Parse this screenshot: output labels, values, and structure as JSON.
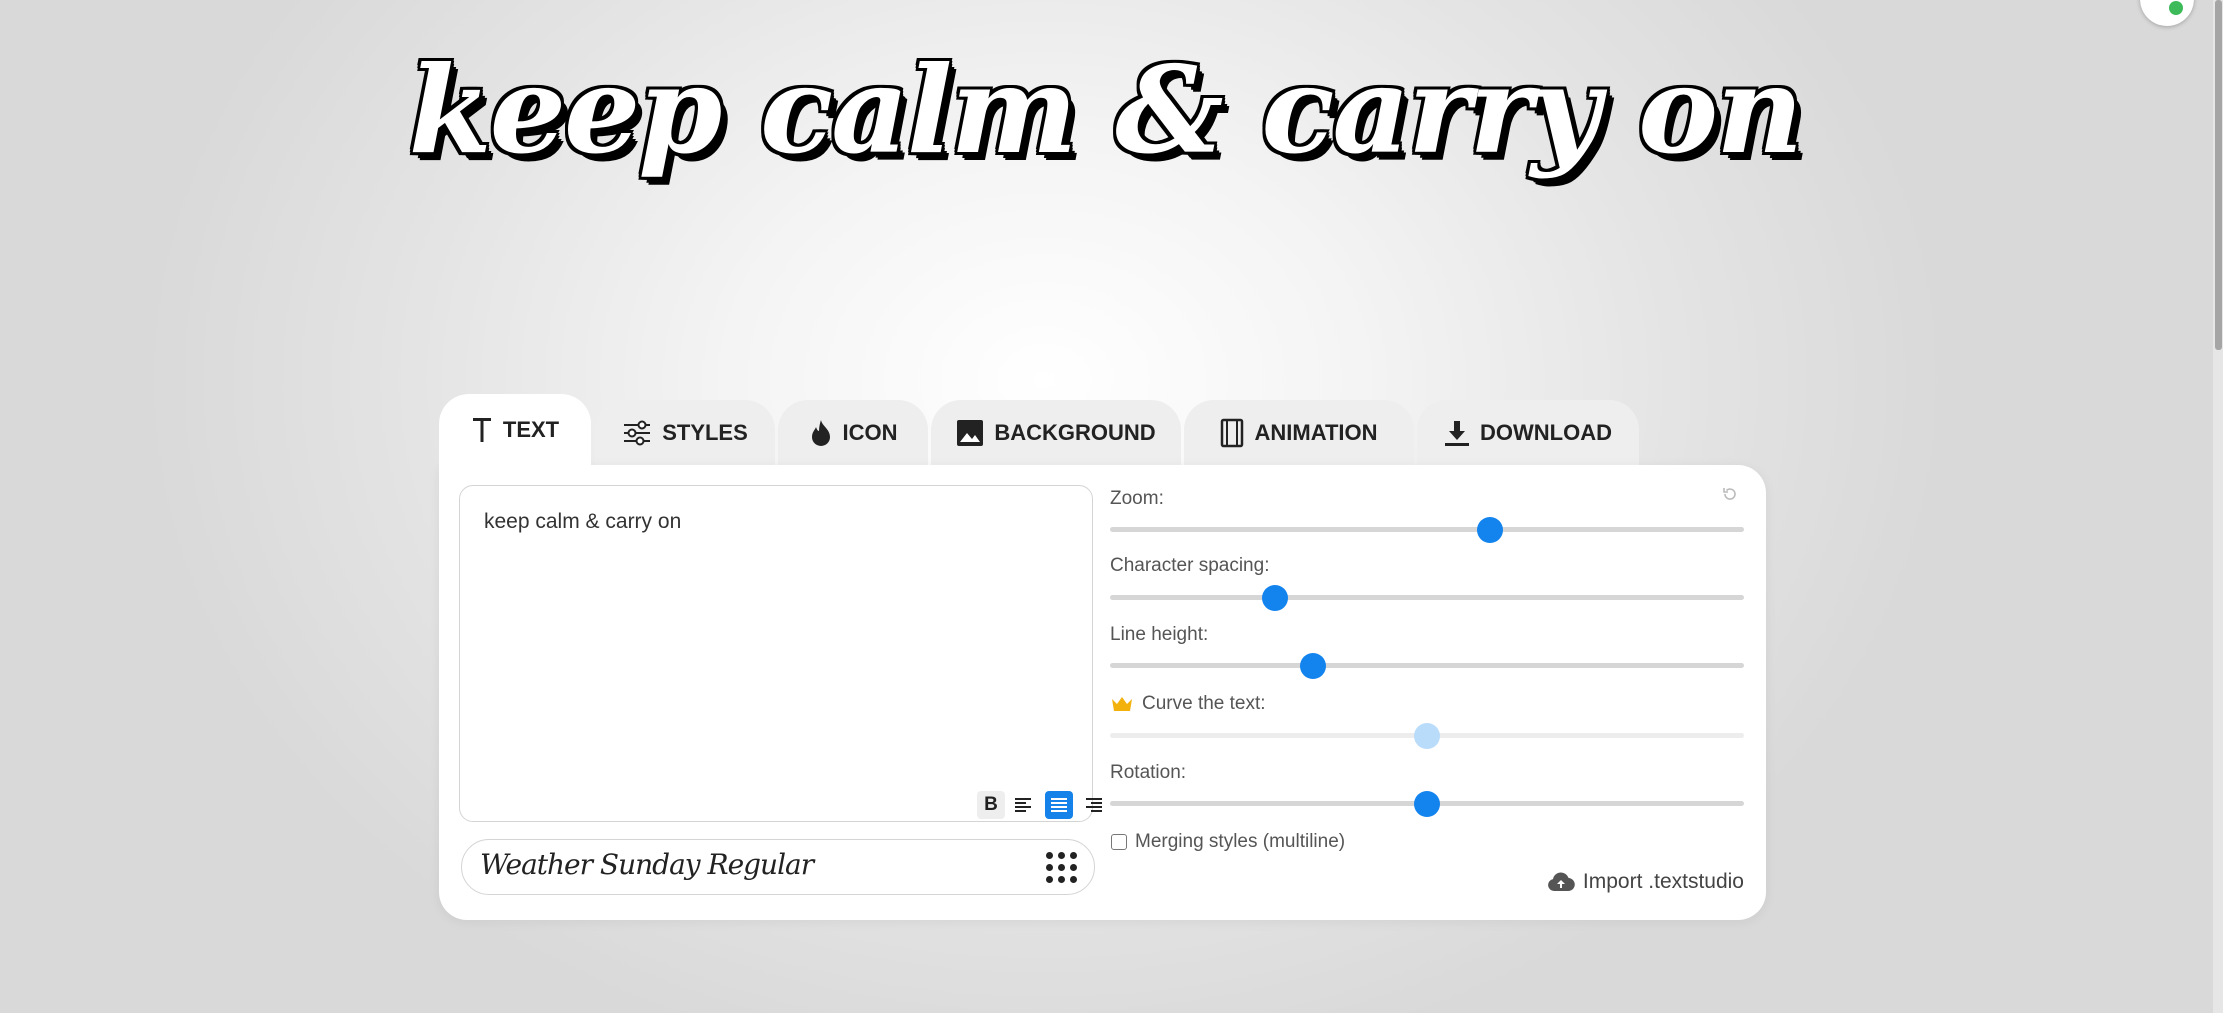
{
  "preview": {
    "text": "keep calm & carry on"
  },
  "tabs": [
    {
      "label": "TEXT",
      "icon": "text-t-icon",
      "active": true
    },
    {
      "label": "STYLES",
      "icon": "sliders-icon",
      "active": false
    },
    {
      "label": "ICON",
      "icon": "flame-icon",
      "active": false
    },
    {
      "label": "BACKGROUND",
      "icon": "image-icon",
      "active": false
    },
    {
      "label": "ANIMATION",
      "icon": "film-icon",
      "active": false
    },
    {
      "label": "DOWNLOAD",
      "icon": "download-icon",
      "active": false
    }
  ],
  "editor": {
    "text_value": "keep calm & carry on",
    "bold_label": "B",
    "alignment": "center",
    "font_name": "Weather Sunday Regular"
  },
  "controls": {
    "zoom": {
      "label": "Zoom:",
      "value_pct": 60
    },
    "char_spacing": {
      "label": "Character spacing:",
      "value_pct": 26
    },
    "line_height": {
      "label": "Line height:",
      "value_pct": 32
    },
    "curve": {
      "label": "Curve the text:",
      "value_pct": 50,
      "premium": true,
      "disabled": true
    },
    "rotation": {
      "label": "Rotation:",
      "value_pct": 50
    },
    "merge": {
      "label": "Merging styles (multiline)",
      "checked": false
    },
    "import_label": "Import .textstudio"
  },
  "colors": {
    "accent": "#1383ee",
    "premium": "#f2b10c"
  }
}
